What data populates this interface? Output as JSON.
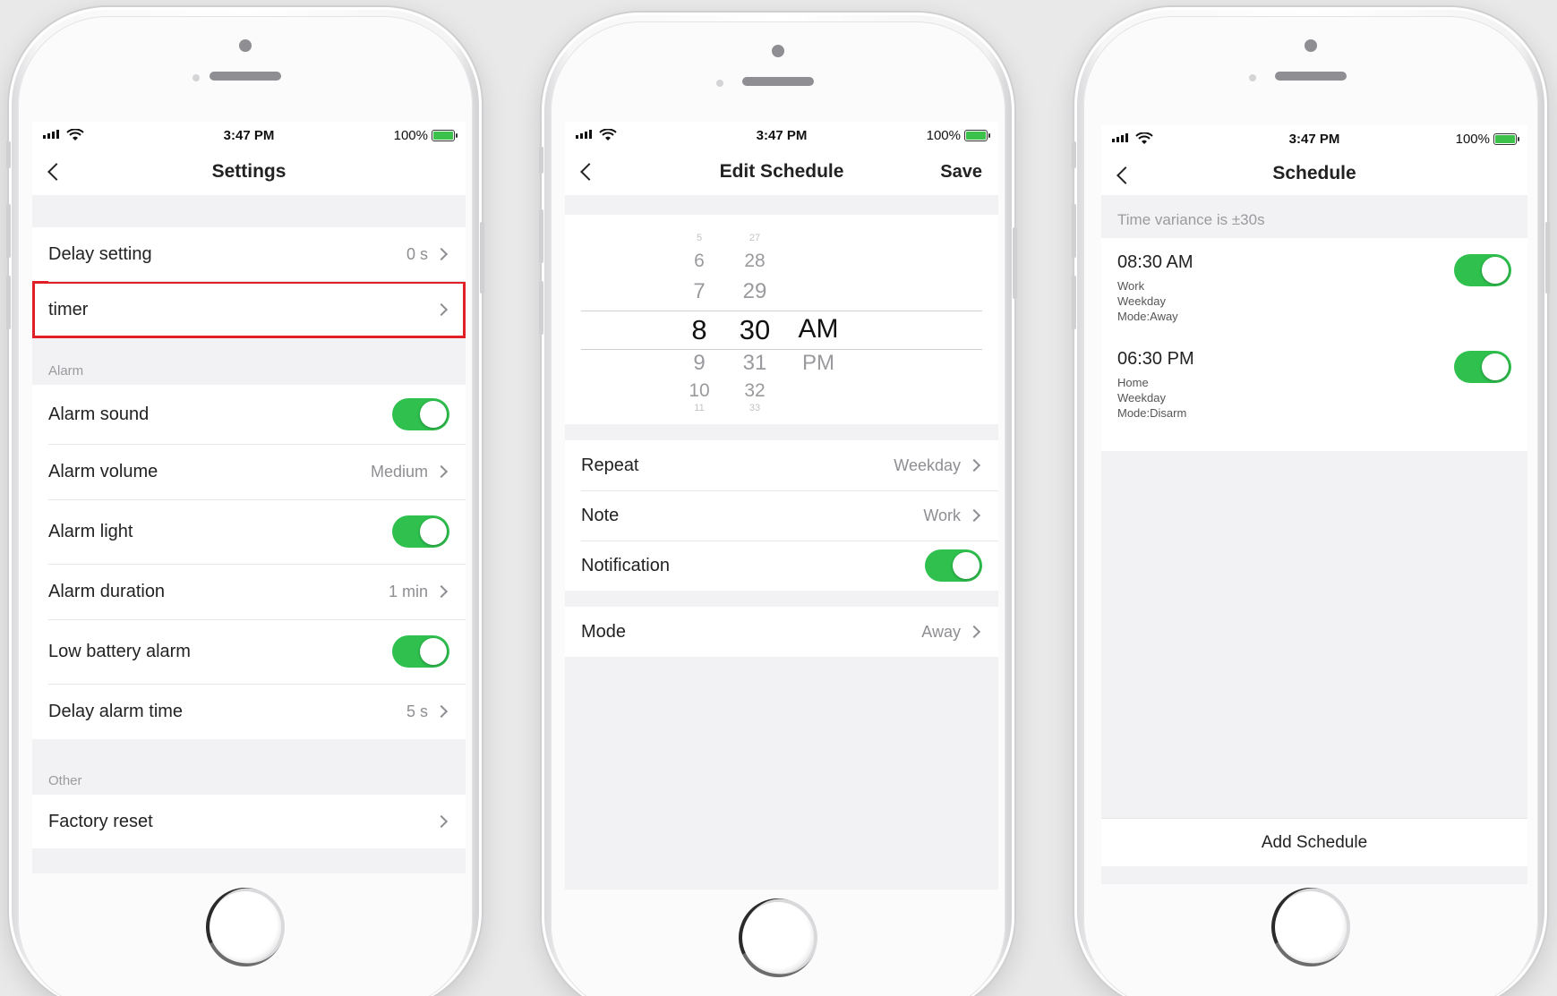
{
  "status": {
    "time": "3:47 PM",
    "battery": "100%"
  },
  "settings": {
    "title": "Settings",
    "rows_top": [
      {
        "label": "Delay setting",
        "value": "0 s"
      },
      {
        "label": "timer",
        "value": ""
      }
    ],
    "alarm_label": "Alarm",
    "alarm_rows": [
      {
        "label": "Alarm sound",
        "type": "toggle",
        "on": true
      },
      {
        "label": "Alarm volume",
        "value": "Medium"
      },
      {
        "label": "Alarm light",
        "type": "toggle",
        "on": true
      },
      {
        "label": "Alarm duration",
        "value": "1 min"
      },
      {
        "label": "Low battery alarm",
        "type": "toggle",
        "on": true
      },
      {
        "label": "Delay alarm time",
        "value": "5 s"
      }
    ],
    "other_label": "Other",
    "other_rows": [
      {
        "label": "Factory reset",
        "value": ""
      }
    ]
  },
  "edit": {
    "title": "Edit Schedule",
    "save_label": "Save",
    "picker": {
      "hours": [
        "5",
        "6",
        "7",
        "8",
        "9",
        "10",
        "11"
      ],
      "minutes": [
        "27",
        "28",
        "29",
        "30",
        "31",
        "32",
        "33"
      ],
      "ampm": [
        "AM",
        "PM"
      ]
    },
    "repeat_label": "Repeat",
    "repeat_value": "Weekday",
    "note_label": "Note",
    "note_value": "Work",
    "notification_label": "Notification",
    "mode_label": "Mode",
    "mode_value": "Away"
  },
  "schedule": {
    "title": "Schedule",
    "variance": "Time variance is  ±30s",
    "items": [
      {
        "time": "08:30 AM",
        "line1": "Work",
        "line2": "Weekday",
        "line3": "Mode:Away"
      },
      {
        "time": "06:30 PM",
        "line1": "Home",
        "line2": "Weekday",
        "line3": "Mode:Disarm"
      }
    ],
    "add_label": "Add Schedule"
  },
  "colors": {
    "toggle_on": "#2fc04e",
    "highlight": "#e11f26",
    "battery": "#3cc24a"
  }
}
